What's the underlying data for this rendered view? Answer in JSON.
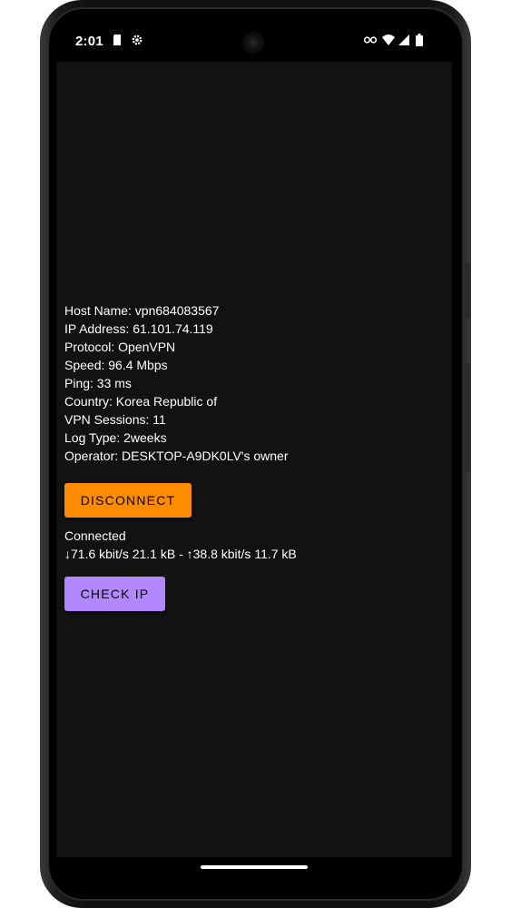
{
  "status_bar": {
    "time": "2:01",
    "left_icons": [
      "sd-card-icon",
      "settings-gear-icon"
    ],
    "right_icons": [
      "vpn-key-icon",
      "wifi-icon",
      "cell-signal-icon",
      "battery-icon"
    ]
  },
  "server_info": {
    "lines": [
      "Host Name: vpn684083567",
      "IP Address: 61.101.74.119",
      "Protocol: OpenVPN",
      "Speed: 96.4 Mbps",
      "Ping: 33 ms",
      "Country: Korea Republic of",
      "VPN Sessions: 11",
      "Log Type: 2weeks",
      "Operator: DESKTOP-A9DK0LV's owner"
    ]
  },
  "actions": {
    "disconnect_label": "DISCONNECT",
    "check_ip_label": "CHECK IP"
  },
  "connection": {
    "status": "Connected",
    "traffic": "↓71.6 kbit/s 21.1 kB - ↑38.8 kbit/s 11.7 kB"
  },
  "colors": {
    "screen_background": "#121212",
    "disconnect_button": "#ff8c00",
    "check_ip_button": "#b388ff",
    "text": "#ffffff"
  }
}
